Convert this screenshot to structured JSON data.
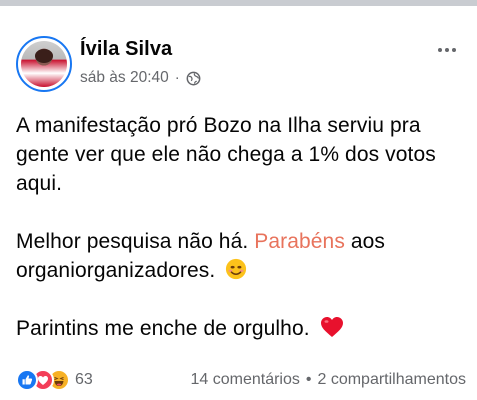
{
  "post": {
    "author": "Ívila Silva",
    "timestamp": "sáb às 20:40",
    "separator": "·",
    "privacy_icon": "globe-icon",
    "more_icon": "more-options-icon",
    "body": {
      "p1": "A manifestação pró Bozo na Ilha serviu pra gente ver que ele não chega a 1% dos votos aqui.",
      "p2_before": "Melhor pesquisa não há. ",
      "p2_highlight": "Parabéns",
      "p2_after": " aos organiorganizadores.",
      "p2_emoji": "smiling-face-emoji",
      "p3": "Parintins me enche de orgulho.",
      "p3_emoji": "red-heart-emoji"
    },
    "reactions": {
      "icons": [
        "like-icon",
        "love-icon",
        "haha-icon"
      ],
      "count": "63"
    },
    "stats": {
      "comments": "14 comentários",
      "dot": "•",
      "shares": "2 compartilhamentos"
    }
  },
  "colors": {
    "accent": "#1877f2",
    "highlight": "#e8735c",
    "secondary_text": "#65676b",
    "love": "#f33e58",
    "haha": "#f7b125"
  }
}
